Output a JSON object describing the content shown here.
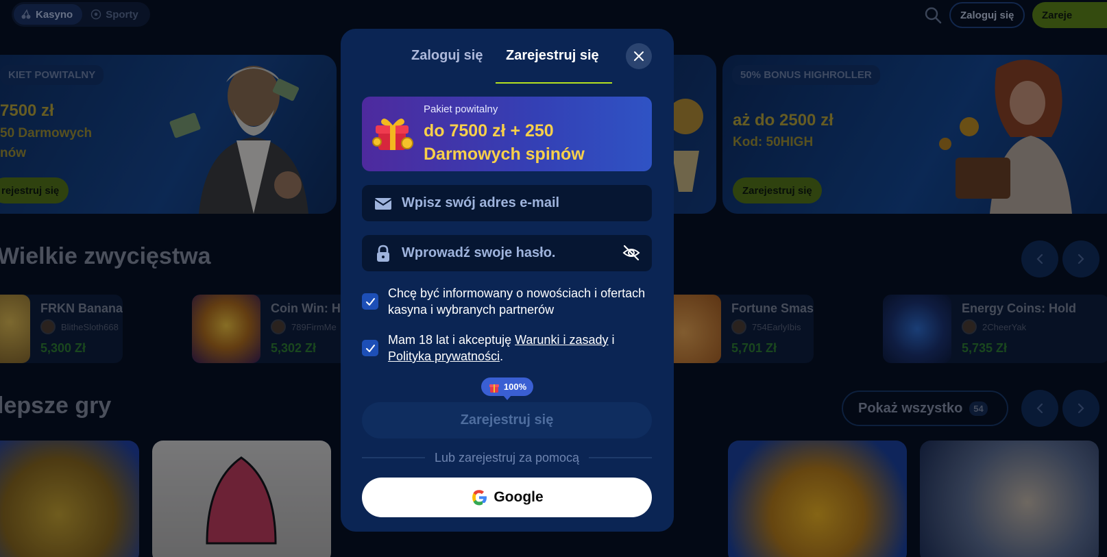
{
  "topbar": {
    "tab_casino": "Kasyno",
    "tab_sports": "Sporty",
    "login_label": "Zaloguj się",
    "register_label": "Zareje"
  },
  "promos": {
    "left": {
      "tag": "KIET POWITALNY",
      "amount": "7500 zł",
      "sub1": "50 Darmowych",
      "sub2": "nów",
      "button": "rejestruj się"
    },
    "right": {
      "tag": "50% BONUS HIGHROLLER",
      "amount": "aż do 2500 zł",
      "sub1": "Kod: 50HIGH",
      "button": "Zarejestruj się"
    }
  },
  "sections": {
    "big_wins_title": "Wielkie zwycięstwa",
    "best_games_title": "lepsze gry",
    "show_all_label": "Pokaż wszystko",
    "show_all_count": "54"
  },
  "wins": [
    {
      "game": "FRKN Bananas",
      "user": "BlitheSloth668",
      "amount": "5,300 Zł"
    },
    {
      "game": "Coin Win: H",
      "user": "789FirmMe",
      "amount": "5,302 Zł"
    },
    {
      "game": "Fortune Smash",
      "user": "754EarlyIbis",
      "amount": "5,701 Zł"
    },
    {
      "game": "Energy Coins: Hold",
      "user": "2CheerYak",
      "amount": "5,735 Zł"
    }
  ],
  "modal": {
    "tab_login": "Zaloguj się",
    "tab_register": "Zarejestruj się",
    "bonus_kicker": "Pakiet powitalny",
    "bonus_text": "do 7500 zł + 250 Darmowych spinów",
    "email_placeholder": "Wpisz swój adres e-mail",
    "password_placeholder": "Wprowadź swoje hasło.",
    "newsletter_text": "Chcę być informowany o nowościach i ofertach kasyna i wybranych partnerów",
    "terms_prefix": "Mam 18 lat i akceptuję ",
    "terms_link": "Warunki i zasady",
    "terms_mid": " i ",
    "privacy_link": "Polityka prywatności",
    "terms_suffix": ".",
    "bonus_pill": "100%",
    "submit_label": "Zarejestruj się",
    "divider_text": "Lub zarejestruj za pomocą",
    "google_label": "Google"
  },
  "colors": {
    "modal_bg": "#0b2554",
    "accent_lime": "#b6e21f",
    "bonus_yellow": "#f8d04a",
    "checkbox_blue": "#1d4fb7"
  }
}
